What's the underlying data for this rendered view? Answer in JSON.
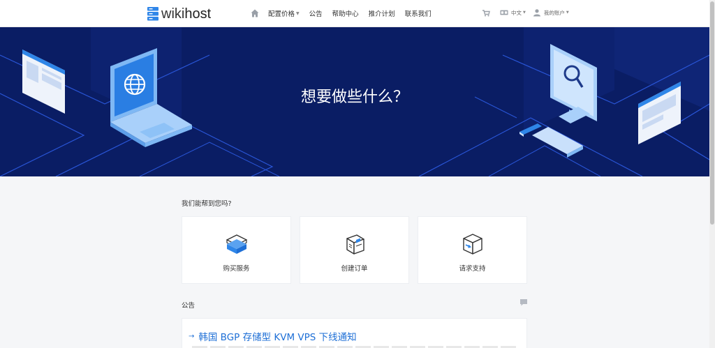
{
  "header": {
    "logo_prefix": "wiki",
    "logo_suffix": "host",
    "nav": [
      {
        "label": "配置价格",
        "has_caret": true
      },
      {
        "label": "公告"
      },
      {
        "label": "帮助中心"
      },
      {
        "label": "推介计划"
      },
      {
        "label": "联系我们"
      }
    ],
    "language": "中文",
    "account": "我的账户"
  },
  "hero": {
    "title": "想要做些什么？"
  },
  "help": {
    "label": "我们能帮到您吗?",
    "cards": [
      {
        "label": "购买服务",
        "icon": "box-icon"
      },
      {
        "label": "创建订单",
        "icon": "package-icon"
      },
      {
        "label": "请求支持",
        "icon": "support-box-icon"
      }
    ]
  },
  "announcements": {
    "label": "公告",
    "items": [
      {
        "title": "韩国 BGP 存储型 KVM VPS 下线通知"
      }
    ]
  },
  "colors": {
    "hero_bg": "#0a1d64",
    "link": "#1e6fd6",
    "accent": "#2f86e8"
  }
}
